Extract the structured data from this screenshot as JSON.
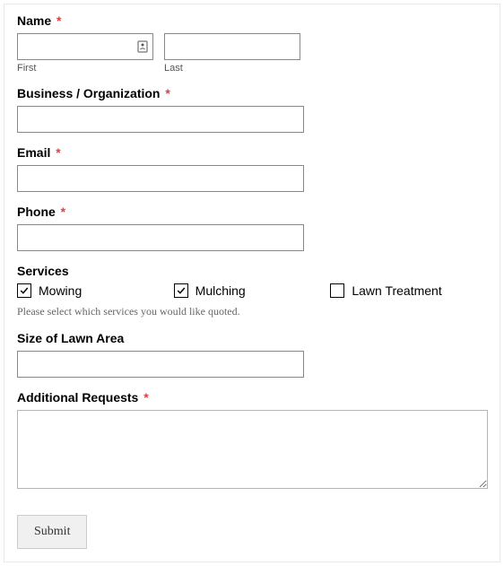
{
  "fields": {
    "name": {
      "label": "Name",
      "required": true,
      "first": {
        "sublabel": "First",
        "value": ""
      },
      "last": {
        "sublabel": "Last",
        "value": ""
      }
    },
    "business": {
      "label": "Business / Organization",
      "required": true,
      "value": ""
    },
    "email": {
      "label": "Email",
      "required": true,
      "value": ""
    },
    "phone": {
      "label": "Phone",
      "required": true,
      "value": ""
    },
    "services": {
      "label": "Services",
      "options": [
        {
          "label": "Mowing",
          "checked": true
        },
        {
          "label": "Mulching",
          "checked": true
        },
        {
          "label": "Lawn Treatment",
          "checked": false
        }
      ],
      "hint": "Please select which services you would like quoted."
    },
    "lawn_size": {
      "label": "Size of Lawn Area",
      "value": ""
    },
    "additional": {
      "label": "Additional Requests",
      "required": true,
      "value": ""
    }
  },
  "submit_label": "Submit",
  "required_marker": "*"
}
